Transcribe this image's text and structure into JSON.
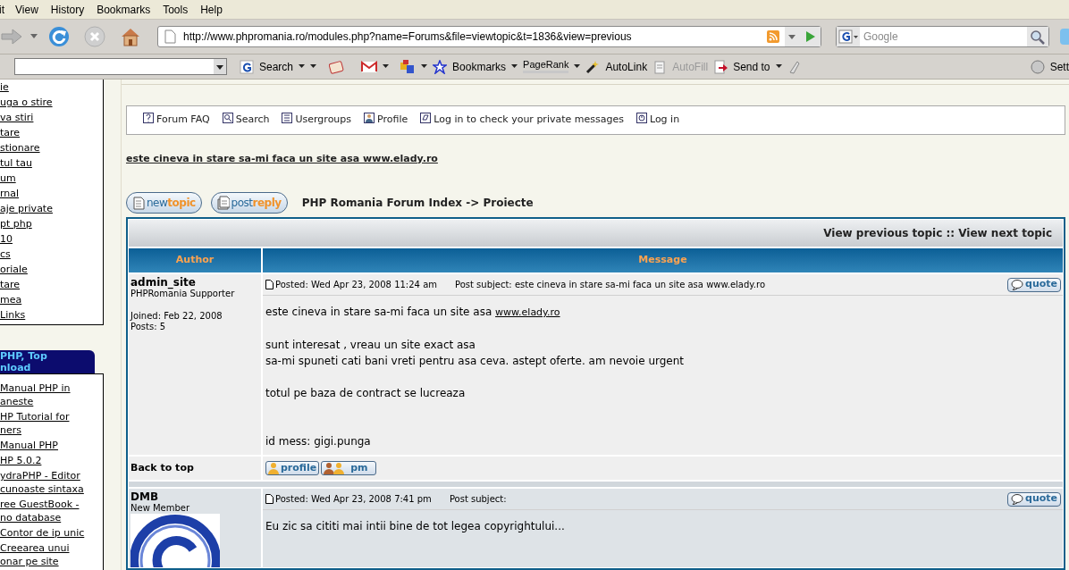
{
  "menu_bar": [
    "it",
    "View",
    "History",
    "Bookmarks",
    "Tools",
    "Help"
  ],
  "address_bar": {
    "url": "http://www.phpromania.ro/modules.php?name=Forums&file=viewtopic&t=1836&view=previous"
  },
  "search_box": {
    "placeholder": "Google"
  },
  "google_toolbar": {
    "items": [
      {
        "kind": "search",
        "label": "Search"
      },
      {
        "kind": "bookmarks",
        "label": "Bookmarks"
      },
      {
        "kind": "pagerank",
        "label": "PageRank"
      },
      {
        "kind": "autolink",
        "label": "AutoLink"
      },
      {
        "kind": "autofill",
        "label": "AutoFill",
        "disabled": true
      },
      {
        "kind": "sendto",
        "label": "Send to"
      }
    ],
    "settings": "Sett"
  },
  "sidebar": {
    "menu_items": [
      "ie",
      "uga o stire",
      "va stiri",
      "tare",
      "stionare",
      "tul tau",
      "um",
      "rnal",
      "aje private",
      "pt php",
      "10",
      "cs",
      "oriale",
      "tare",
      "mea",
      "Links"
    ],
    "block_title": [
      "PHP, Top",
      "nload"
    ],
    "block_items": [
      [
        "Manual PHP in",
        "aneste"
      ],
      [
        "HP Tutorial for",
        "ners"
      ],
      [
        "Manual PHP"
      ],
      [
        "HP 5.0.2"
      ],
      [
        "ydraPHP - Editor",
        "cunoaste sintaxa"
      ],
      [
        "ree GuestBook -",
        "no database"
      ],
      [
        "Contor de ip unic"
      ],
      [
        "Creearea unui",
        "onar pe site"
      ]
    ]
  },
  "forum_nav": [
    {
      "kind": "faq",
      "label": "Forum FAQ"
    },
    {
      "kind": "search",
      "label": "Search"
    },
    {
      "kind": "groups",
      "label": "Usergroups"
    },
    {
      "kind": "profile",
      "label": "Profile"
    },
    {
      "kind": "messages",
      "label": "Log in to check your private messages"
    },
    {
      "kind": "login",
      "label": "Log in"
    }
  ],
  "topic_title": "este cineva in stare sa-mi faca un site asa www.elady.ro",
  "buttons": [
    {
      "kind": "new",
      "first": "new",
      "second": "topic"
    },
    {
      "kind": "reply",
      "first": "post",
      "second": "reply"
    }
  ],
  "breadcrumb": "PHP Romania Forum Index -> Proiecte",
  "topic_nav": "View previous topic :: View next topic",
  "table": {
    "columns": [
      "Author",
      "Message"
    ],
    "posts": [
      {
        "author": "admin_site",
        "rank": "PHPRomania Supporter",
        "joined": "Joined: Feb 22, 2008",
        "posts": "Posts: 5",
        "posted": "Posted: Wed Apr 23, 2008 11:24 am",
        "subject": "Post subject: este cineva in stare sa-mi faca un site asa www.elady.ro",
        "quote": "quote",
        "paragraphs": [
          {
            "lines": [
              {
                "text": "este cineva in stare sa-mi faca un site asa",
                "link": "www.elady.ro"
              }
            ]
          },
          {
            "lines": [
              {
                "text": "sunt interesat , vreau un site exact asa"
              },
              {
                "text": "sa-mi spuneti cati bani vreti pentru asa ceva. astept oferte. am nevoie urgent"
              }
            ]
          },
          {
            "lines": [
              {
                "text": "totul pe baza de contract se lucreaza"
              }
            ]
          },
          {
            "kind": "signature",
            "lines": [
              {
                "text": "id mess: gigi.punga"
              }
            ]
          }
        ],
        "footer": {
          "back": "Back to top",
          "profile": "profile",
          "pm": "pm"
        }
      },
      {
        "author": "DMB",
        "rank": "New Member",
        "avatar": {
          "kind": "picture"
        },
        "posted": "Posted: Wed Apr 23, 2008 7:41 pm",
        "subject": "Post subject:",
        "quote": "quote",
        "paragraphs": [
          {
            "lines": [
              {
                "text": "Eu zic sa cititi mai intii bine de tot legea copyrightului..."
              }
            ]
          }
        ]
      }
    ]
  }
}
